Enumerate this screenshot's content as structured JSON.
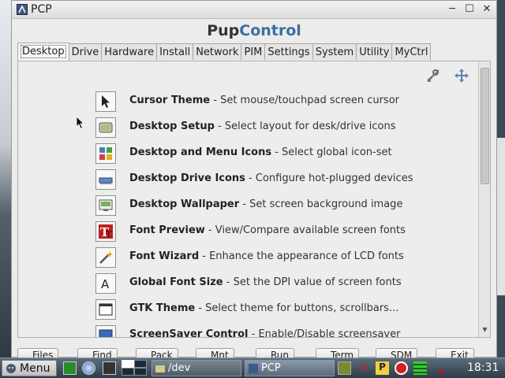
{
  "window": {
    "title": "PCP",
    "heading_part1": "Pup",
    "heading_part2": "Control",
    "controls": {
      "minimize": "─",
      "maximize": "☐",
      "close": "✕"
    }
  },
  "tabs": [
    "Desktop",
    "Drive",
    "Hardware",
    "Install",
    "Network",
    "PIM",
    "Settings",
    "System",
    "Utility",
    "MyCtrl"
  ],
  "active_tab": "Desktop",
  "items": [
    {
      "title": "Cursor Theme",
      "desc": " - Set mouse/touchpad screen cursor",
      "icon": "cursor-icon"
    },
    {
      "title": "Desktop Setup",
      "desc": " - Select layout for desk/drive icons",
      "icon": "desktop-setup-icon"
    },
    {
      "title": "Desktop and Menu Icons",
      "desc": " - Select global icon-set",
      "icon": "icon-set-icon"
    },
    {
      "title": "Desktop Drive Icons",
      "desc": " - Configure hot-plugged devices",
      "icon": "drive-icon"
    },
    {
      "title": "Desktop Wallpaper",
      "desc": " - Set screen background image",
      "icon": "wallpaper-icon"
    },
    {
      "title": "Font Preview",
      "desc": " - View/Compare available screen fonts",
      "icon": "font-preview-icon"
    },
    {
      "title": "Font Wizard",
      "desc": " - Enhance the appearance of LCD fonts",
      "icon": "wand-icon"
    },
    {
      "title": "Global Font Size",
      "desc": " - Set the DPI value of screen fonts",
      "icon": "font-size-icon"
    },
    {
      "title": "GTK Theme",
      "desc": " - Select theme for buttons, scrollbars...",
      "icon": "gtk-theme-icon"
    },
    {
      "title": "ScreenSaver Control",
      "desc": " - Enable/Disable screensaver",
      "icon": "screensaver-icon"
    }
  ],
  "bottom_buttons": [
    "Files",
    "Find",
    "Pack",
    "Mnt",
    "Run",
    "Term",
    "SDM",
    "Exit"
  ],
  "taskbar": {
    "menu_label": "Menu",
    "tasks": [
      "/dev",
      "PCP"
    ],
    "clock": "18:31"
  }
}
